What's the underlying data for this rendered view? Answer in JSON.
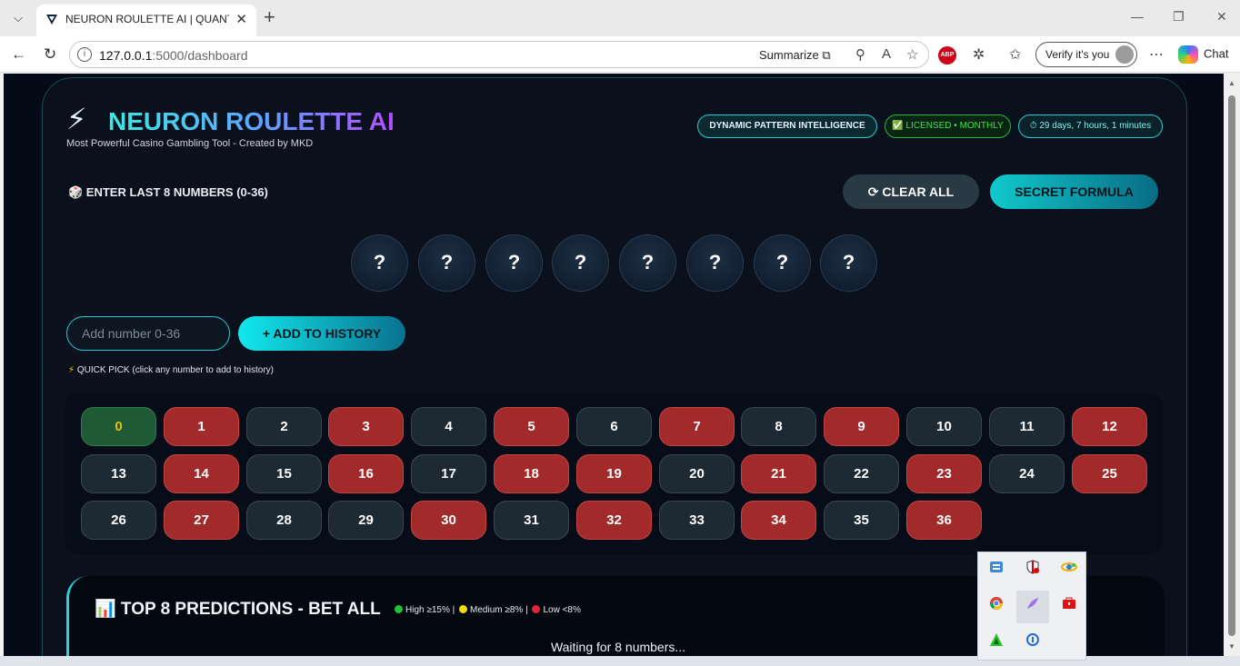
{
  "browser": {
    "tab_title": "NEURON ROULETTE AI | QUANTUM",
    "url_host": "127.0.0.1",
    "url_path": ":5000/dashboard",
    "summarize_label": "Summarize",
    "verify_label": "Verify it's you",
    "chat_label": "Chat",
    "abp_label": "ABP"
  },
  "header": {
    "brand": "NEURON ROULETTE AI",
    "subtitle": "Most Powerful Casino Gambling Tool - Created by MKD",
    "badges": {
      "dynamic": "DYNAMIC PATTERN INTELLIGENCE",
      "license": "✅ LICENSED • MONTHLY",
      "time": "⏱ 29 days, 7 hours, 1 minutes"
    }
  },
  "entry": {
    "label": "🎲 ENTER LAST 8 NUMBERS (0-36)",
    "clear_button": "⟳ CLEAR ALL",
    "secret_button": "SECRET FORMULA",
    "slots": [
      "?",
      "?",
      "?",
      "?",
      "?",
      "?",
      "?",
      "?"
    ],
    "input_placeholder": "Add number 0-36",
    "add_button": "+ ADD TO HISTORY",
    "quick_pick_label": "QUICK PICK (click any number to add to history)"
  },
  "quick_pick": {
    "numbers": [
      {
        "n": "0",
        "color": "green"
      },
      {
        "n": "1",
        "color": "red"
      },
      {
        "n": "2",
        "color": "black"
      },
      {
        "n": "3",
        "color": "red"
      },
      {
        "n": "4",
        "color": "black"
      },
      {
        "n": "5",
        "color": "red"
      },
      {
        "n": "6",
        "color": "black"
      },
      {
        "n": "7",
        "color": "red"
      },
      {
        "n": "8",
        "color": "black"
      },
      {
        "n": "9",
        "color": "red"
      },
      {
        "n": "10",
        "color": "black"
      },
      {
        "n": "11",
        "color": "black"
      },
      {
        "n": "12",
        "color": "red"
      },
      {
        "n": "13",
        "color": "black"
      },
      {
        "n": "14",
        "color": "red"
      },
      {
        "n": "15",
        "color": "black"
      },
      {
        "n": "16",
        "color": "red"
      },
      {
        "n": "17",
        "color": "black"
      },
      {
        "n": "18",
        "color": "red"
      },
      {
        "n": "19",
        "color": "red"
      },
      {
        "n": "20",
        "color": "black"
      },
      {
        "n": "21",
        "color": "red"
      },
      {
        "n": "22",
        "color": "black"
      },
      {
        "n": "23",
        "color": "red"
      },
      {
        "n": "24",
        "color": "black"
      },
      {
        "n": "25",
        "color": "red"
      },
      {
        "n": "26",
        "color": "black"
      },
      {
        "n": "27",
        "color": "red"
      },
      {
        "n": "28",
        "color": "black"
      },
      {
        "n": "29",
        "color": "black"
      },
      {
        "n": "30",
        "color": "red"
      },
      {
        "n": "31",
        "color": "black"
      },
      {
        "n": "32",
        "color": "red"
      },
      {
        "n": "33",
        "color": "black"
      },
      {
        "n": "34",
        "color": "red"
      },
      {
        "n": "35",
        "color": "black"
      },
      {
        "n": "36",
        "color": "red"
      }
    ]
  },
  "predictions": {
    "title": "📊 TOP 8 PREDICTIONS - BET ALL",
    "legend_high": "High ≥15% |",
    "legend_medium": "Medium ≥8% |",
    "legend_low": "Low <8%",
    "colors": {
      "high": "#22c33a",
      "medium": "#f5d90a",
      "low": "#e0243a"
    },
    "waiting": "Waiting for 8 numbers..."
  },
  "tray": {
    "icons": [
      "network-icon",
      "shield-icon",
      "satellite-icon",
      "chrome-icon",
      "feather-icon",
      "toolbox-icon",
      "triangle-icon",
      "update-icon"
    ]
  }
}
